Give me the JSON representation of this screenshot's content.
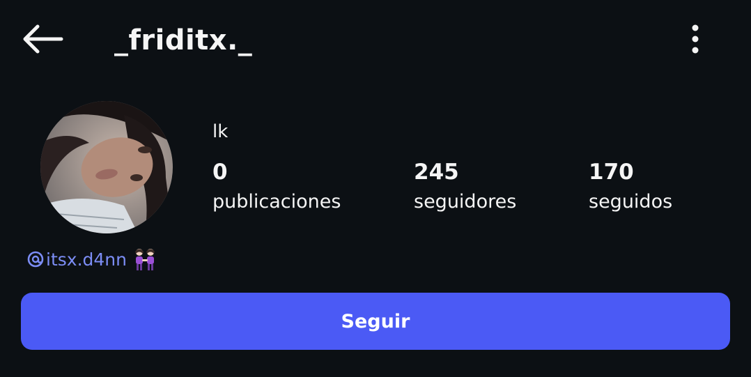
{
  "header": {
    "username": "_friditx._",
    "back_icon": "arrow-left-icon",
    "more_icon": "more-vertical-icon"
  },
  "profile": {
    "display_name": "lk",
    "stats": [
      {
        "count": "0",
        "label": "publicaciones"
      },
      {
        "count": "245",
        "label": "seguidores"
      },
      {
        "count": "170",
        "label": "seguidos"
      }
    ],
    "threads_handle": "itsx.d4nn",
    "threads_icon": "threads-icon",
    "emoji": "two-women-holding-hands"
  },
  "actions": {
    "follow_label": "Seguir"
  },
  "colors": {
    "background": "#0c1014",
    "text": "#f5f5f5",
    "link": "#7c8df5",
    "follow_button": "#4b5af5"
  }
}
